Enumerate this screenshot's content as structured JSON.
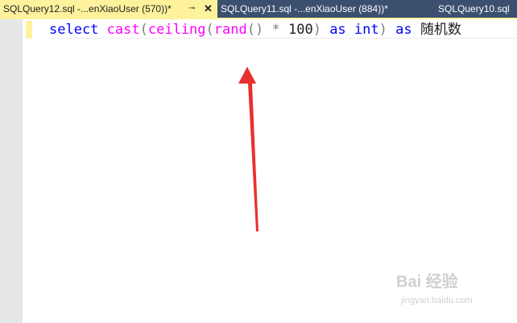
{
  "tabs": [
    {
      "label": "SQLQuery12.sql -...enXiaoUser (570))*",
      "active": true,
      "pin_icon": "pin-icon",
      "close_icon": "close-icon"
    },
    {
      "label": "SQLQuery11.sql -...enXiaoUser (884))*",
      "active": false
    },
    {
      "label": "SQLQuery10.sql",
      "active": false
    }
  ],
  "editor": {
    "tokens": {
      "select": "select",
      "cast": "cast",
      "paren_open": "(",
      "ceiling": "ceiling",
      "rand": "rand",
      "rand_parens": "()",
      "times": "*",
      "hundred": "100",
      "paren_close": ")",
      "as1": "as",
      "int": "int",
      "as2": "as",
      "alias": "随机数"
    }
  },
  "annotation": {
    "icon": "red-arrow-icon",
    "color": "#e8312f"
  },
  "watermark": {
    "logo": "Bai 经验",
    "url": "jingyan.baidu.com"
  },
  "colors": {
    "keyword": "#0000ff",
    "function": "#ff00ff",
    "operator": "#808080",
    "active_tab": "#fff29d",
    "tab_strip": "#3b4f6f"
  }
}
